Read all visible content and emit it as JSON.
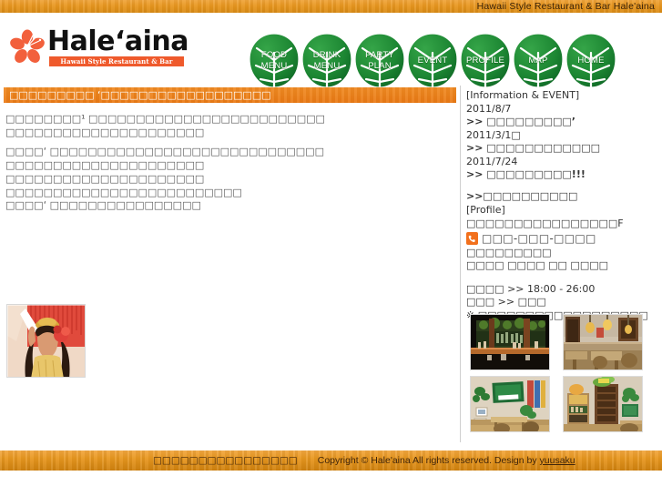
{
  "topbar": {
    "title": "Hawaii Style Restaurant & Bar Hale'aina"
  },
  "logo": {
    "name": "Hale‘aina",
    "tagline": "Hawaii Style Restaurant & Bar",
    "flower_color": "#f2603c",
    "tagline_bg": "#ef5a2c"
  },
  "nav": {
    "items": [
      {
        "line1": "FOOD",
        "line2": "MENU"
      },
      {
        "line1": "DRINK",
        "line2": "MENU"
      },
      {
        "line1": "PARTY",
        "line2": "PLAN"
      },
      {
        "line1": "EVENT",
        "line2": ""
      },
      {
        "line1": "PROFILE",
        "line2": ""
      },
      {
        "line1": "MAP",
        "line2": ""
      },
      {
        "line1": "HOME",
        "line2": ""
      }
    ],
    "leaf_color": "#1f8a35"
  },
  "main": {
    "headline": "□□□□□□□□□ ‘□□□□□□□□□□□□□□□□□□",
    "headline_bg": "#ea7a14",
    "paragraph1": "□□□□□□□□¹ □□□□□□□□□□□□□□□□□□□□□□□□□\n□□□□□□□□□□□□□□□□□□□□□",
    "paragraph2": "□□□□‘ □□□□□□□□□□□□□□□□□□□□□□□□□□□□□\n□□□□□□□□□□□□□□□□□□□□□\n□□□□□□□□□□□□□□□□□□□□□\n□□□□□□□□□□□□□□□□□□□□□□□□□",
    "paragraph3": "□□□□‘ □□□□□□□□□□□□□□□□",
    "photo_alt": "hula-dancer"
  },
  "sidebar": {
    "info": {
      "title": "[Information & EVENT]",
      "entries": [
        {
          "date": "2011/8/7",
          "link": ">> □□□□□□□□□’"
        },
        {
          "date": "2011/3/1□",
          "link": ">> □□□□□□□□□□□□"
        },
        {
          "date": "2011/7/24",
          "link": ">> □□□□□□□□□!!!"
        }
      ],
      "extra_link": ">>□□□□□□□□□□"
    },
    "profile": {
      "title": "[Profile]",
      "address": "□□□□□□□□□□□□□□□□F",
      "phone": "□□□-□□□-□□□□",
      "phone_icon_color": "#f2701c",
      "line3": "□□□□□□□□□",
      "line4": "□□□□ □□□□ □□ □□□□",
      "hours": "□□□□ >> 18:00 - 26:00",
      "closed": "□□□ >> □□□",
      "note": "※ □□□□□□□□□□□□□□□□□□"
    },
    "photos": [
      {
        "name": "bar-counter-photo"
      },
      {
        "name": "dining-room-photo"
      },
      {
        "name": "hawaii-sign-wall-photo"
      },
      {
        "name": "entrance-corner-photo"
      }
    ]
  },
  "footer": {
    "left_text": "□□□□□□□□□□□□□□□□",
    "copyright": "Copyright © Hale'aina All rights reserved. Design by",
    "designer": "yuusaku"
  }
}
